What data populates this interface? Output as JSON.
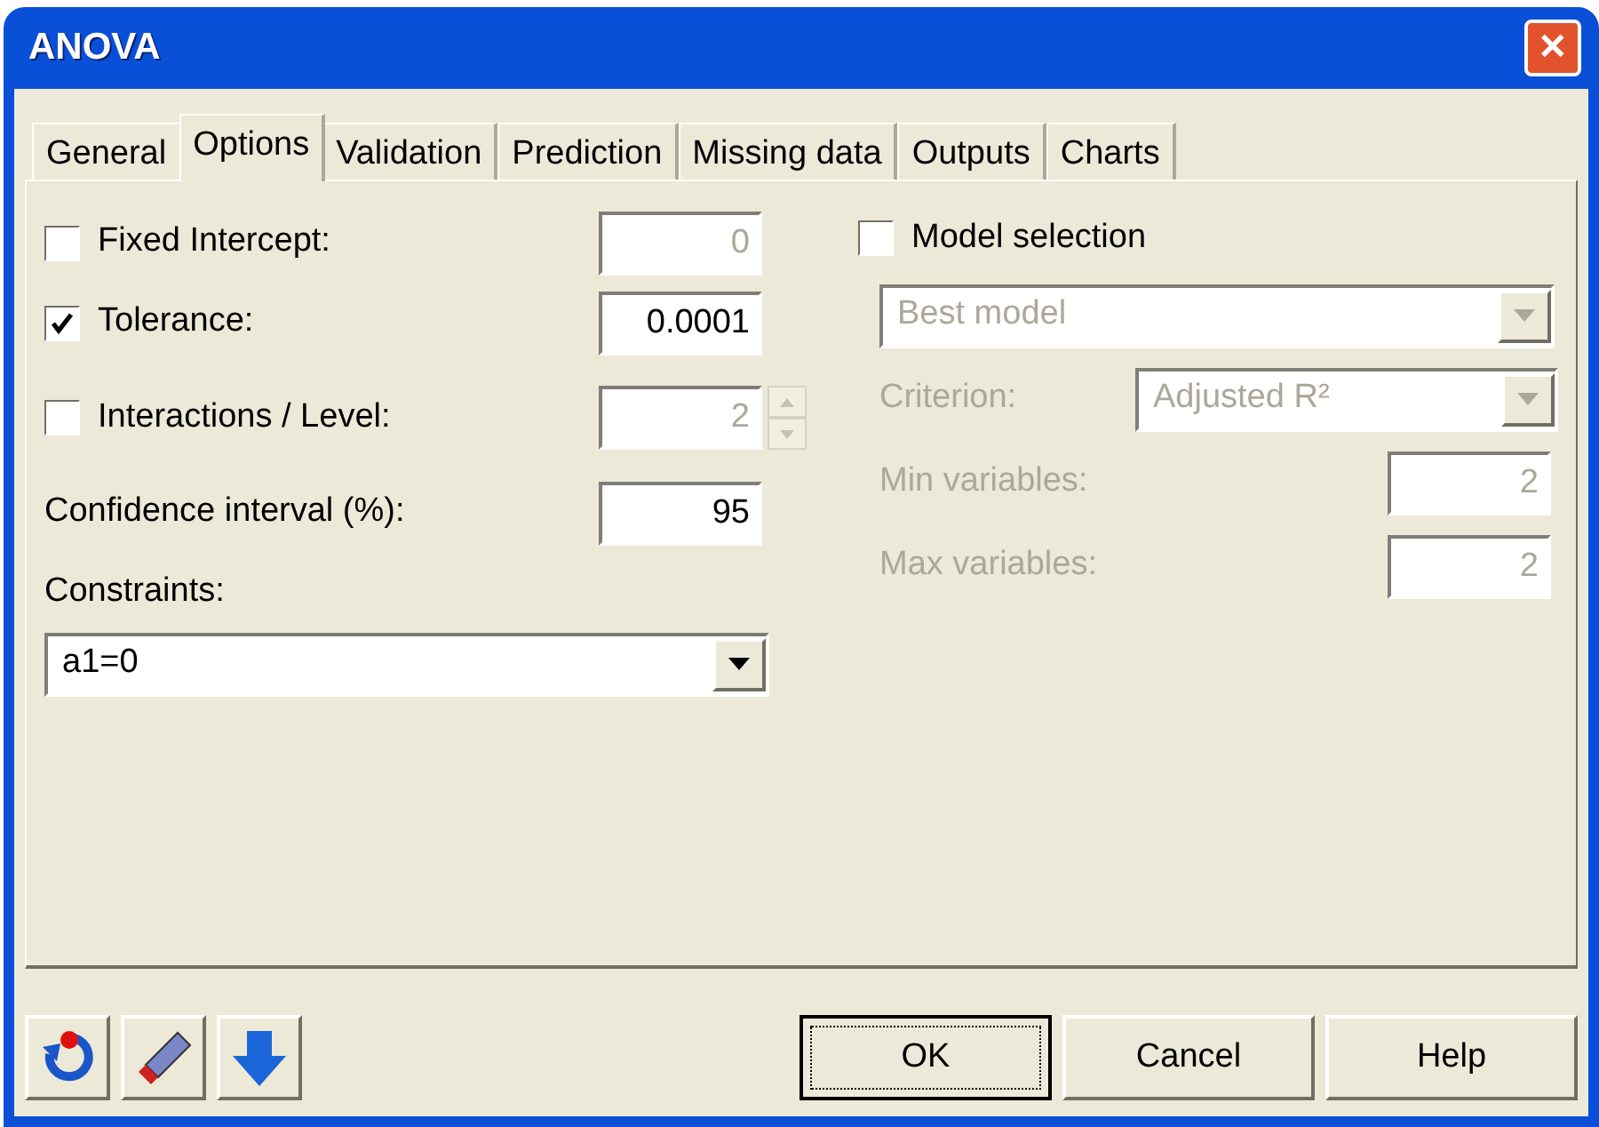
{
  "window": {
    "title": "ANOVA",
    "close": "✕"
  },
  "tabs": [
    {
      "label": "General",
      "selected": false
    },
    {
      "label": "Options",
      "selected": true
    },
    {
      "label": "Validation",
      "selected": false
    },
    {
      "label": "Prediction",
      "selected": false
    },
    {
      "label": "Missing data",
      "selected": false
    },
    {
      "label": "Outputs",
      "selected": false
    },
    {
      "label": "Charts",
      "selected": false
    }
  ],
  "options": [
    {
      "kind": "checkbox",
      "label": "Fixed Intercept:",
      "checked": false,
      "value": "0",
      "disabled": true
    },
    {
      "kind": "checkbox",
      "label": "Tolerance:",
      "checked": true,
      "value": "0.0001",
      "disabled": false
    },
    {
      "kind": "spin",
      "label": "Interactions / Level:",
      "checked": false,
      "value": "2",
      "disabled": true
    },
    {
      "kind": "field",
      "label": "Confidence interval (%):",
      "value": "95",
      "disabled": false
    }
  ],
  "constraints": {
    "label": "Constraints:",
    "value": "a1=0",
    "disabled": false
  },
  "model_selection": {
    "label": "Model selection",
    "checked": false,
    "fields": [
      {
        "kind": "select",
        "value": "Best model",
        "disabled": true
      },
      {
        "kind": "select",
        "label": "Criterion:",
        "value": "Adjusted R²",
        "disabled": true
      },
      {
        "kind": "field",
        "label": "Min variables:",
        "value": "2",
        "disabled": true
      },
      {
        "kind": "field",
        "label": "Max variables:",
        "value": "2",
        "disabled": true
      }
    ]
  },
  "buttons": [
    {
      "label": "OK",
      "default": true
    },
    {
      "label": "Cancel",
      "default": false
    },
    {
      "label": "Help",
      "default": false
    }
  ]
}
